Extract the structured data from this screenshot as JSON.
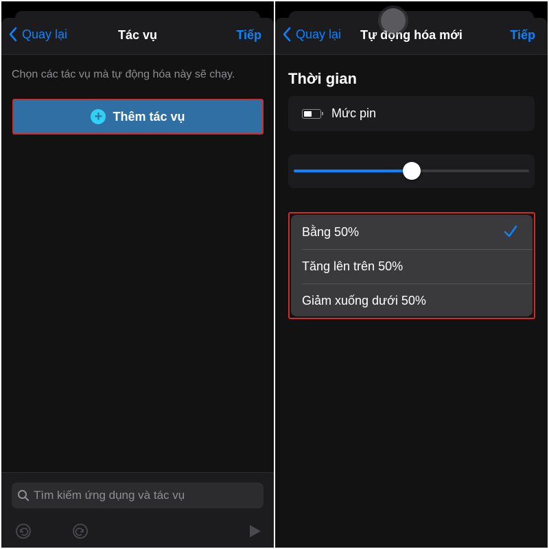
{
  "left_screen": {
    "nav": {
      "back": "Quay lại",
      "title": "Tác vụ",
      "next": "Tiếp"
    },
    "instructions": "Chọn các tác vụ mà tự động hóa này sẽ chạy.",
    "add_action_button": "Thêm tác vụ",
    "search": {
      "placeholder": "Tìm kiếm ứng dụng và tác vụ",
      "value": ""
    },
    "toolbar_icons": [
      "undo-icon",
      "redo-icon",
      "play-icon"
    ]
  },
  "right_screen": {
    "nav": {
      "back": "Quay lại",
      "title": "Tự động hóa mới",
      "next": "Tiếp"
    },
    "section_title": "Thời gian",
    "trigger_label": "Mức pin",
    "slider_value_percent": 50,
    "options": [
      {
        "label": "Bằng 50%",
        "selected": true
      },
      {
        "label": "Tăng lên trên 50%",
        "selected": false
      },
      {
        "label": "Giảm xuống dưới 50%",
        "selected": false
      }
    ]
  },
  "colors": {
    "accent": "#0a84ff",
    "add_button": "#2f6fa3",
    "highlight_border": "#d42a2a",
    "background": "#000000"
  }
}
